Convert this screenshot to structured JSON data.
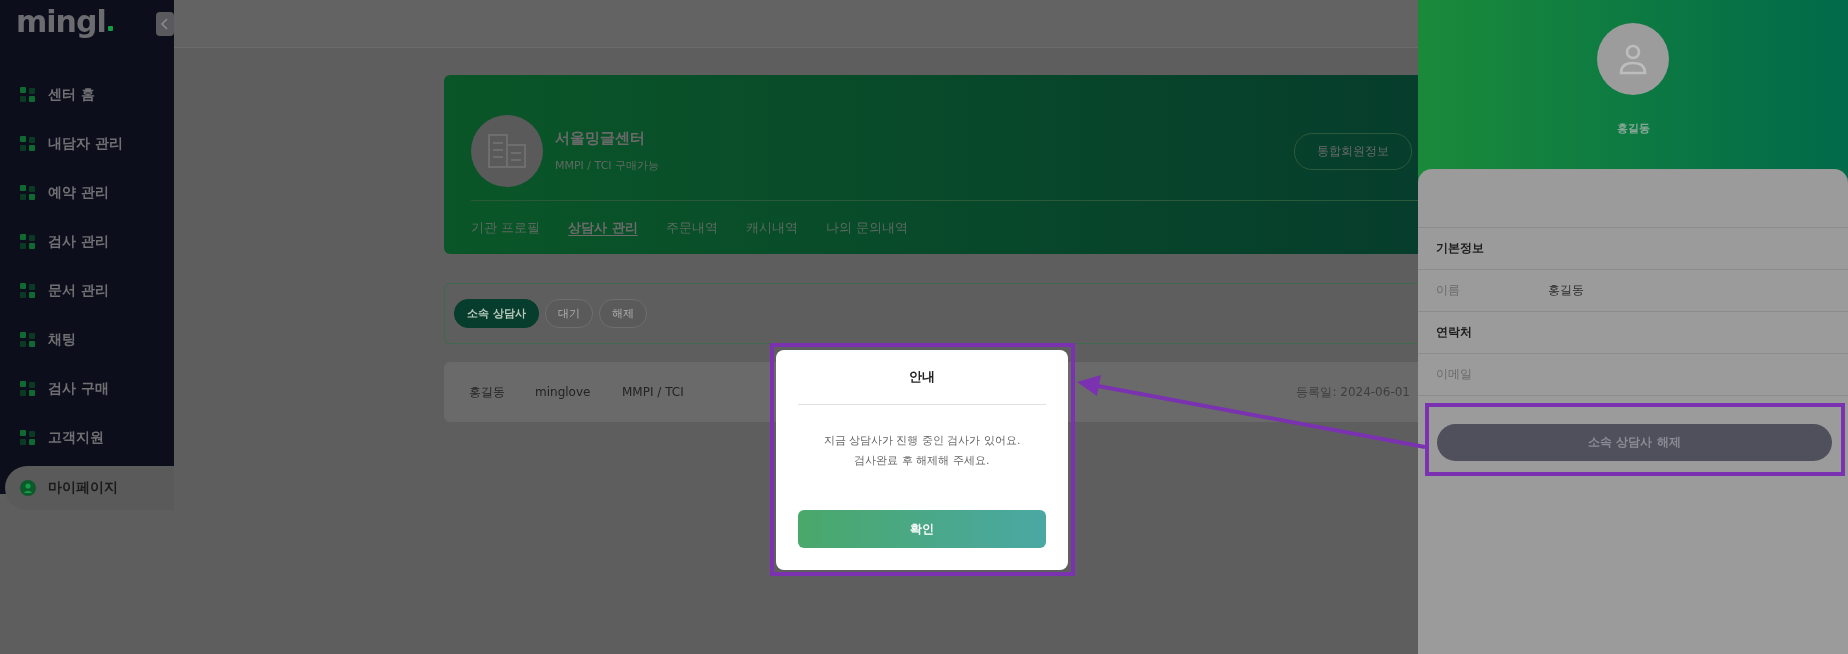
{
  "logo": {
    "text": "mingl"
  },
  "sidebar": {
    "items": [
      {
        "label": "센터 홈",
        "selected": false
      },
      {
        "label": "내담자 관리",
        "selected": false
      },
      {
        "label": "예약 관리",
        "selected": false
      },
      {
        "label": "검사 관리",
        "selected": false
      },
      {
        "label": "문서 관리",
        "selected": false
      },
      {
        "label": "채팅",
        "selected": false
      },
      {
        "label": "검사 구매",
        "selected": false
      },
      {
        "label": "고객지원",
        "selected": false
      },
      {
        "label": "마이페이지",
        "selected": true
      }
    ]
  },
  "profile_card": {
    "name": "서울밍글센터",
    "subtitle": "MMPI / TCI 구매가능",
    "button": "통합회원정보",
    "tabs": [
      {
        "label": "기관 프로필",
        "selected": false
      },
      {
        "label": "상담사 관리",
        "selected": true
      },
      {
        "label": "주문내역",
        "selected": false
      },
      {
        "label": "캐시내역",
        "selected": false
      },
      {
        "label": "나의 문의내역",
        "selected": false
      }
    ]
  },
  "filters": [
    {
      "label": "소속 상담사",
      "selected": true
    },
    {
      "label": "대기",
      "selected": false
    },
    {
      "label": "해제",
      "selected": false
    }
  ],
  "rows": [
    {
      "name": "홍길동",
      "username": "minglove",
      "tests": "MMPI / TCI",
      "registered": "등록일: 2024-06-01"
    }
  ],
  "dialog": {
    "title": "안내",
    "message": "지금 상담사가 진행 중인 검사가 있어요.\n검사완료 후 해제해 주세요.",
    "button": "확인"
  },
  "detail_panel": {
    "name": "홍길동",
    "sections": [
      {
        "kind": "heading",
        "label": "기본정보"
      },
      {
        "kind": "field",
        "label": "이름",
        "value": "홍길동"
      },
      {
        "kind": "heading",
        "label": "연락처"
      },
      {
        "kind": "field",
        "label": "이메일"
      }
    ],
    "button": "소속 상담사 해제"
  }
}
